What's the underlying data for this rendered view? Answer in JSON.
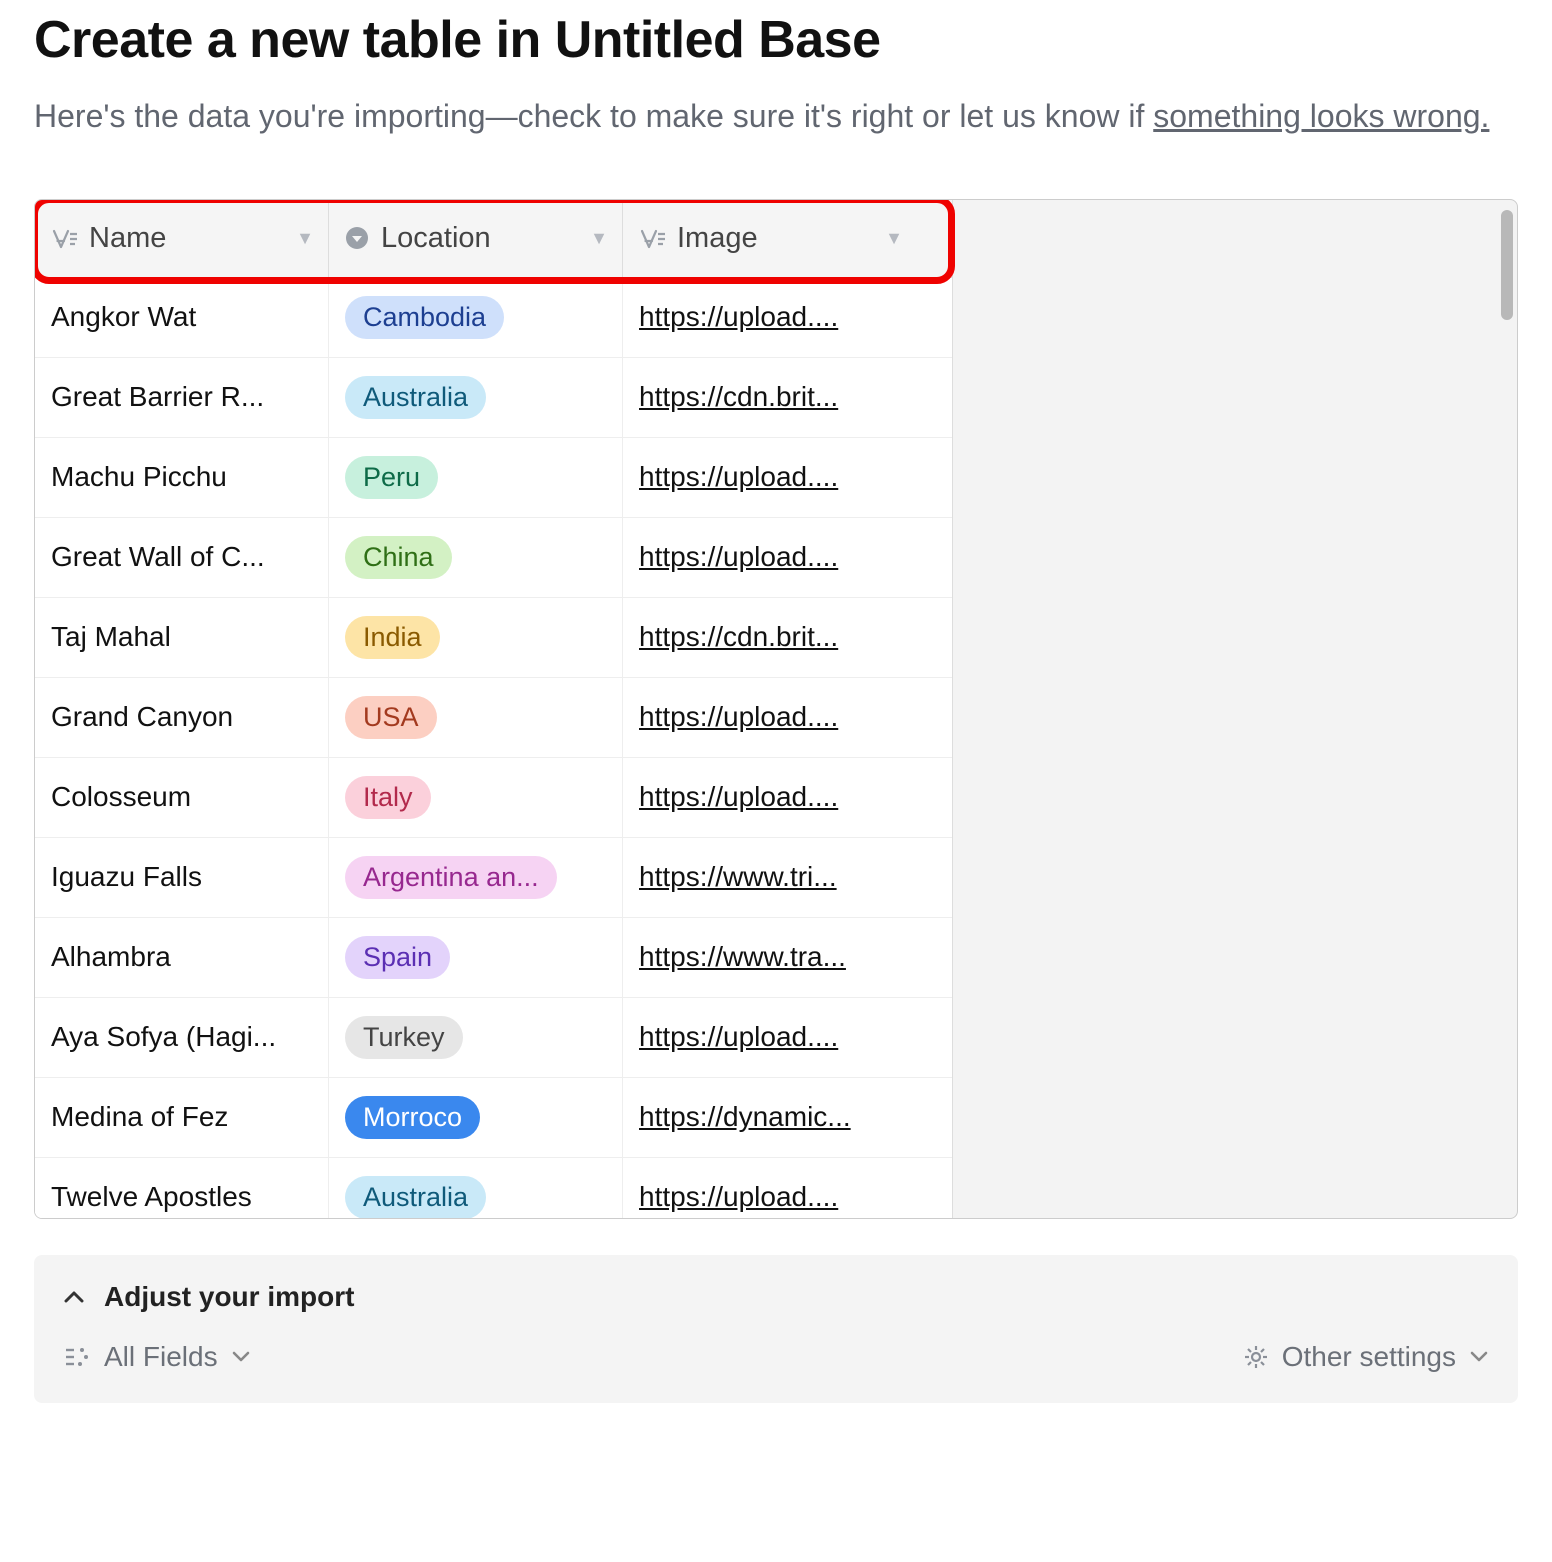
{
  "title": "Create a new table in Untitled Base",
  "subtitle": {
    "text_before": "Here's the data you're importing—check to make sure it's right or let us know if ",
    "link_text": "something looks wrong."
  },
  "columns": [
    {
      "label": "Name",
      "icon": "text"
    },
    {
      "label": "Location",
      "icon": "select"
    },
    {
      "label": "Image",
      "icon": "text"
    }
  ],
  "rows": [
    {
      "name": "Angkor Wat",
      "location": "Cambodia",
      "pill_bg": "#cfe0fb",
      "pill_fg": "#1d3f91",
      "image": "https://upload...."
    },
    {
      "name": "Great Barrier R...",
      "location": "Australia",
      "pill_bg": "#c9e9f8",
      "pill_fg": "#0f5a7a",
      "image": "https://cdn.brit..."
    },
    {
      "name": "Machu Picchu",
      "location": "Peru",
      "pill_bg": "#c7f0dd",
      "pill_fg": "#0e6b48",
      "image": "https://upload...."
    },
    {
      "name": "Great Wall of C...",
      "location": "China",
      "pill_bg": "#d3f1c4",
      "pill_fg": "#2f6f16",
      "image": "https://upload...."
    },
    {
      "name": "Taj Mahal",
      "location": "India",
      "pill_bg": "#fde4a6",
      "pill_fg": "#8a5a00",
      "image": "https://cdn.brit..."
    },
    {
      "name": "Grand Canyon",
      "location": "USA",
      "pill_bg": "#fccfc2",
      "pill_fg": "#a33a1f",
      "image": "https://upload...."
    },
    {
      "name": "Colosseum",
      "location": "Italy",
      "pill_bg": "#fbd0db",
      "pill_fg": "#b22a4c",
      "image": "https://upload...."
    },
    {
      "name": "Iguazu Falls",
      "location": "Argentina an...",
      "pill_bg": "#f6d3f3",
      "pill_fg": "#97288f",
      "image": "https://www.tri..."
    },
    {
      "name": "Alhambra",
      "location": "Spain",
      "pill_bg": "#e3d3fb",
      "pill_fg": "#5b2fb3",
      "image": "https://www.tra..."
    },
    {
      "name": "Aya Sofya (Hagi...",
      "location": "Turkey",
      "pill_bg": "#e6e6e6",
      "pill_fg": "#444444",
      "image": "https://upload...."
    },
    {
      "name": "Medina of Fez",
      "location": "Morroco",
      "pill_bg": "#3a88ee",
      "pill_fg": "#ffffff",
      "image": "https://dynamic..."
    },
    {
      "name": "Twelve Apostles",
      "location": "Australia",
      "pill_bg": "#c9e9f8",
      "pill_fg": "#0f5a7a",
      "image": "https://upload...."
    }
  ],
  "footer": {
    "adjust_label": "Adjust your import",
    "all_fields_label": "All Fields",
    "other_settings_label": "Other settings"
  }
}
